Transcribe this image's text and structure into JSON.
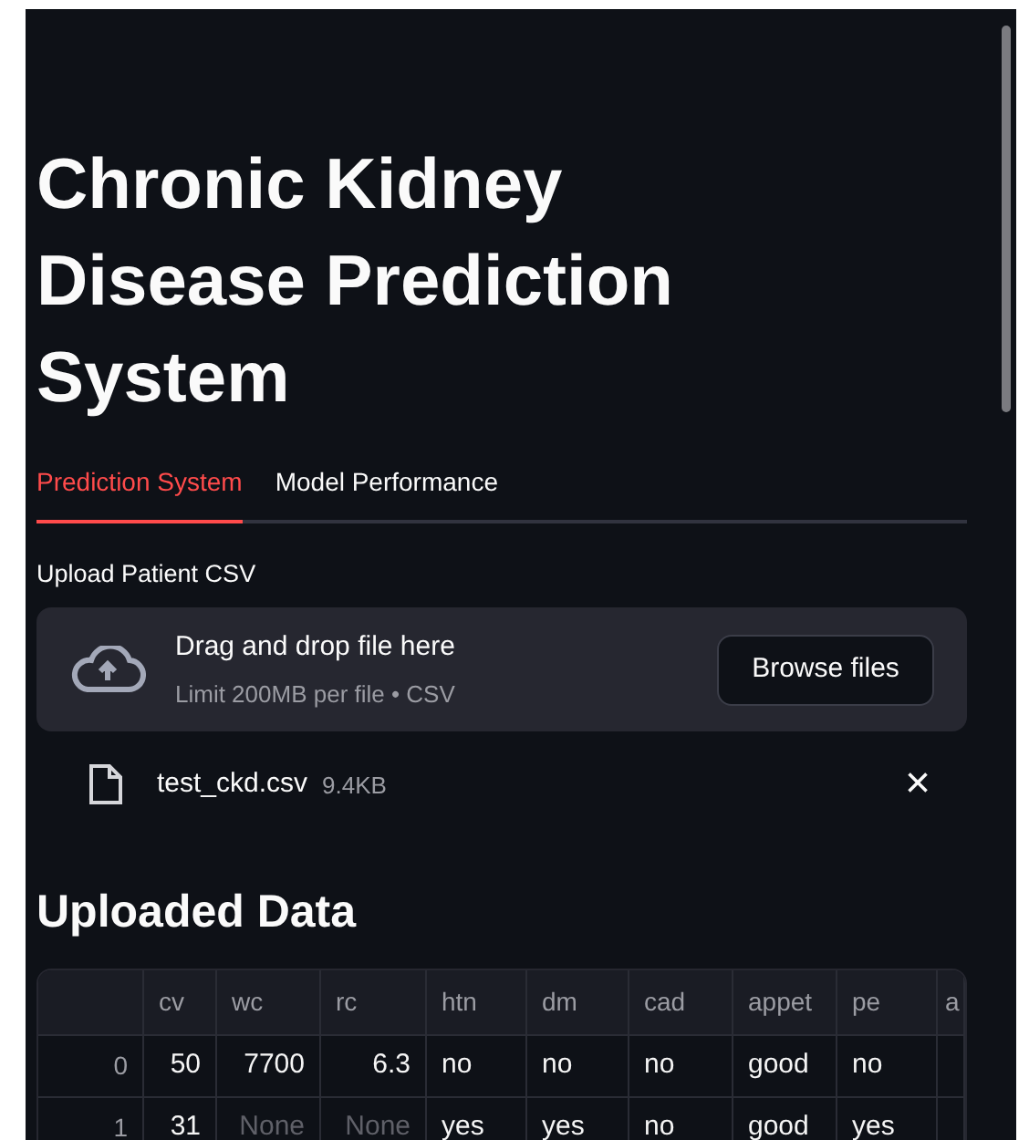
{
  "title": "Chronic Kidney Disease Prediction System",
  "tabs": [
    {
      "label": "Prediction System",
      "selected": true
    },
    {
      "label": "Model Performance",
      "selected": false
    }
  ],
  "uploader": {
    "label": "Upload Patient CSV",
    "drop_text": "Drag and drop file here",
    "limit_text": "Limit 200MB per file • CSV",
    "button": "Browse files"
  },
  "file": {
    "name": "test_ckd.csv",
    "size": "9.4KB",
    "remove": "×"
  },
  "section_heading": "Uploaded Data",
  "table": {
    "columns": [
      "cv",
      "wc",
      "rc",
      "htn",
      "dm",
      "cad",
      "appet",
      "pe",
      "a"
    ],
    "rows": [
      {
        "index": "0",
        "cells": [
          {
            "text": "50",
            "kind": "number"
          },
          {
            "text": "7700",
            "kind": "number"
          },
          {
            "text": "6.3",
            "kind": "number"
          },
          {
            "text": "no",
            "kind": "text"
          },
          {
            "text": "no",
            "kind": "text"
          },
          {
            "text": "no",
            "kind": "text"
          },
          {
            "text": "good",
            "kind": "text"
          },
          {
            "text": "no",
            "kind": "text"
          }
        ]
      },
      {
        "index": "1",
        "cells": [
          {
            "text": "31",
            "kind": "number"
          },
          {
            "text": "None",
            "kind": "missing"
          },
          {
            "text": "None",
            "kind": "missing"
          },
          {
            "text": "yes",
            "kind": "text"
          },
          {
            "text": "yes",
            "kind": "text"
          },
          {
            "text": "no",
            "kind": "text"
          },
          {
            "text": "good",
            "kind": "text"
          },
          {
            "text": "yes",
            "kind": "text"
          }
        ]
      }
    ]
  }
}
